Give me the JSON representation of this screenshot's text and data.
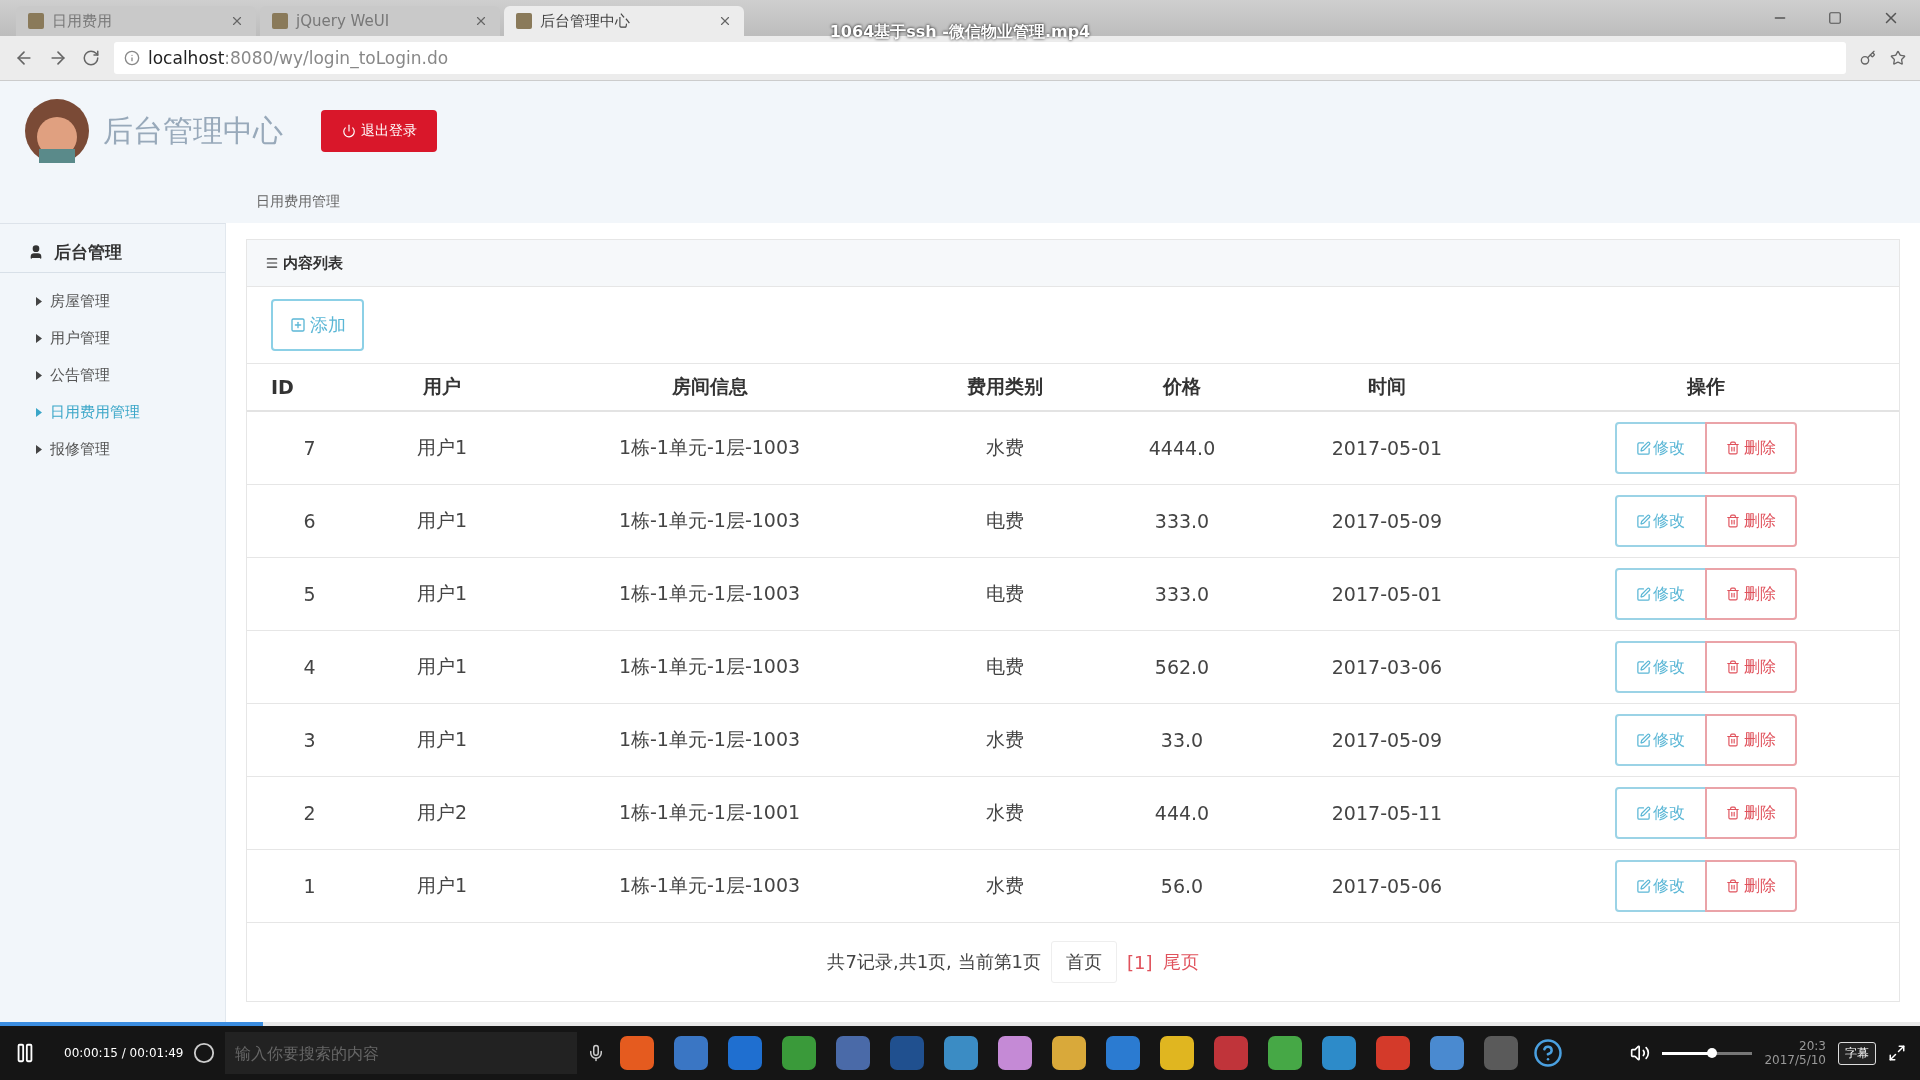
{
  "browser": {
    "tabs": [
      {
        "label": "日用费用",
        "selected": false
      },
      {
        "label": "jQuery WeUI",
        "selected": false
      },
      {
        "label": "后台管理中心",
        "selected": true
      }
    ],
    "url_host": "localhost",
    "url_path": ":8080/wy/login_toLogin.do"
  },
  "video": {
    "title": "1064基于ssh -微信物业管理.mp4",
    "progress": {
      "level": 0.137
    },
    "time": "00:00:15 / 00:01:49",
    "subtitle_button": "字幕",
    "volume": {
      "level": 0.55
    }
  },
  "header": {
    "title": "后台管理中心",
    "logout": "退出登录"
  },
  "breadcrumb": "日用费用管理",
  "sidebar": {
    "title": "后台管理",
    "items": [
      {
        "label": "房屋管理",
        "selected": false
      },
      {
        "label": "用户管理",
        "selected": false
      },
      {
        "label": "公告管理",
        "selected": false
      },
      {
        "label": "日用费用管理",
        "selected": true
      },
      {
        "label": "报修管理",
        "selected": false
      }
    ]
  },
  "panel": {
    "title": "内容列表",
    "add_button": "添加"
  },
  "table": {
    "columns": [
      "ID",
      "用户",
      "房间信息",
      "费用类别",
      "价格",
      "时间",
      "操作"
    ],
    "rows": [
      {
        "id": "7",
        "user": "用户1",
        "room": "1栋-1单元-1层-1003",
        "type": "水费",
        "price": "4444.0",
        "date": "2017-05-01",
        "edit": "修改",
        "delete": "删除"
      },
      {
        "id": "6",
        "user": "用户1",
        "room": "1栋-1单元-1层-1003",
        "type": "电费",
        "price": "333.0",
        "date": "2017-05-09",
        "edit": "修改",
        "delete": "删除"
      },
      {
        "id": "5",
        "user": "用户1",
        "room": "1栋-1单元-1层-1003",
        "type": "电费",
        "price": "333.0",
        "date": "2017-05-01",
        "edit": "修改",
        "delete": "删除"
      },
      {
        "id": "4",
        "user": "用户1",
        "room": "1栋-1单元-1层-1003",
        "type": "电费",
        "price": "562.0",
        "date": "2017-03-06",
        "edit": "修改",
        "delete": "删除"
      },
      {
        "id": "3",
        "user": "用户1",
        "room": "1栋-1单元-1层-1003",
        "type": "水费",
        "price": "33.0",
        "date": "2017-05-09",
        "edit": "修改",
        "delete": "删除"
      },
      {
        "id": "2",
        "user": "用户2",
        "room": "1栋-1单元-1层-1001",
        "type": "水费",
        "price": "444.0",
        "date": "2017-05-11",
        "edit": "修改",
        "delete": "删除"
      },
      {
        "id": "1",
        "user": "用户1",
        "room": "1栋-1单元-1层-1003",
        "type": "水费",
        "price": "56.0",
        "date": "2017-05-06",
        "edit": "修改",
        "delete": "删除"
      }
    ]
  },
  "pagination": {
    "summary": "共7记录,共1页, 当前第1页",
    "first": "首页",
    "current": "[1]",
    "last": "尾页"
  },
  "taskbar": {
    "search_placeholder": "输入你要搜索的内容",
    "clock_time": "20:3",
    "clock_date": "2017/5/10"
  }
}
